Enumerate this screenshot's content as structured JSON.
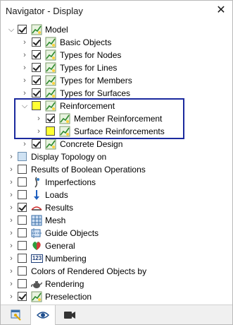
{
  "window": {
    "title": "Navigator - Display"
  },
  "tree": {
    "model": "Model",
    "basic_objects": "Basic Objects",
    "types_nodes": "Types for Nodes",
    "types_lines": "Types for Lines",
    "types_members": "Types for Members",
    "types_surfaces": "Types for Surfaces",
    "reinforcement": "Reinforcement",
    "member_reinforcement": "Member Reinforcement",
    "surface_reinforcements": "Surface Reinforcements",
    "concrete_design": "Concrete Design",
    "display_topology": "Display Topology on",
    "boolean_results": "Results of Boolean Operations",
    "imperfections": "Imperfections",
    "loads": "Loads",
    "results": "Results",
    "mesh": "Mesh",
    "guide_objects": "Guide Objects",
    "general": "General",
    "numbering": "Numbering",
    "colors_rendered": "Colors of Rendered Objects by",
    "rendering": "Rendering",
    "preselection": "Preselection"
  },
  "icons": {
    "numbering_text": "123"
  },
  "colors": {
    "highlight_border": "#1b2a9e",
    "partial_blue": "#cfe2f3",
    "partial_yellow": "#ffff33"
  }
}
